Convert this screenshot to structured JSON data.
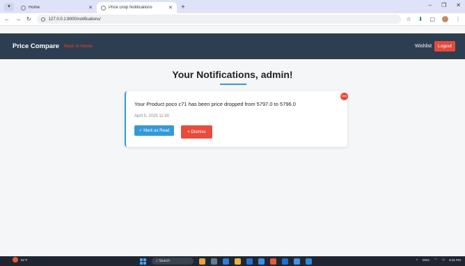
{
  "browser": {
    "tabs": [
      {
        "title": "Home",
        "active": false
      },
      {
        "title": "Price Drop Notifications",
        "active": true
      }
    ],
    "new_tab": "+",
    "url": "127.0.0.1:8000/notifications/",
    "window_controls": [
      "–",
      "❐",
      "✕"
    ]
  },
  "navbar": {
    "brand": "Price Compare",
    "back_link": "Back to Home",
    "wishlist": "Wishlist",
    "logout": "Logout"
  },
  "main": {
    "heading": "Your Notifications, admin!",
    "notification": {
      "message": "Your Product poco c71 has been price dropped from 5797.0 to 5796.0",
      "date": "April 5, 2025 11:30",
      "badge": "New",
      "mark_read": "✓ Mark as Read",
      "dismiss": "× Dismiss"
    }
  },
  "taskbar": {
    "weather": "81°F",
    "search": "Search",
    "lang": "ENG",
    "time": "5:31 PM"
  },
  "colors": {
    "navbar": "#2d3e50",
    "accent": "#3498db",
    "danger": "#e74c3c"
  }
}
